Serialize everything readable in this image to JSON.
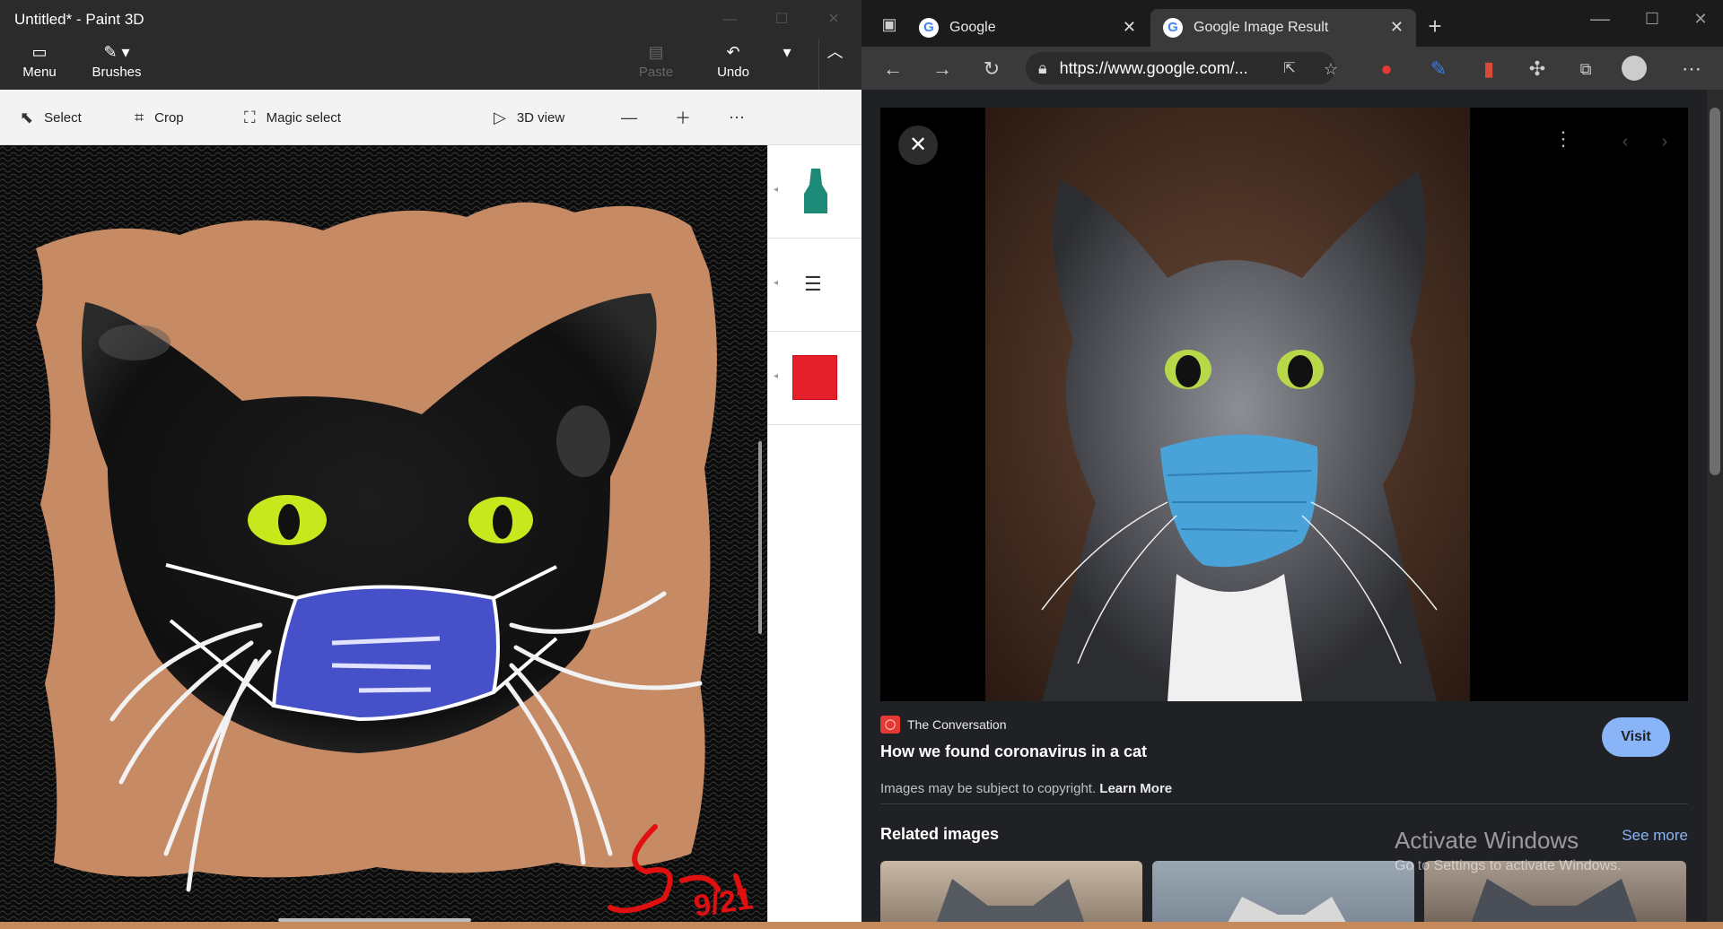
{
  "paint": {
    "title": "Untitled* - Paint 3D",
    "ribbon": {
      "menu_label": "Menu",
      "brushes_label": "Brushes",
      "paste_label": "Paste",
      "undo_label": "Undo"
    },
    "toolbar": {
      "select_label": "Select",
      "crop_label": "Crop",
      "magic_select_label": "Magic select",
      "view3d_label": "3D view"
    },
    "selected_color": "#e5202a",
    "canvas_signature": "9/21"
  },
  "edge": {
    "tabs": [
      {
        "label": "Google"
      },
      {
        "label": "Google Image Result"
      }
    ],
    "url": "https://www.google.com/...",
    "result": {
      "source_name": "The Conversation",
      "title": "How we found coronavirus in a cat",
      "copyright_text": "Images may be subject to copyright.",
      "learn_more_label": "Learn More",
      "visit_label": "Visit"
    },
    "related": {
      "label": "Related images",
      "see_more_label": "See more"
    },
    "watermark": {
      "title": "Activate Windows",
      "subtitle": "Go to Settings to activate Windows."
    }
  }
}
